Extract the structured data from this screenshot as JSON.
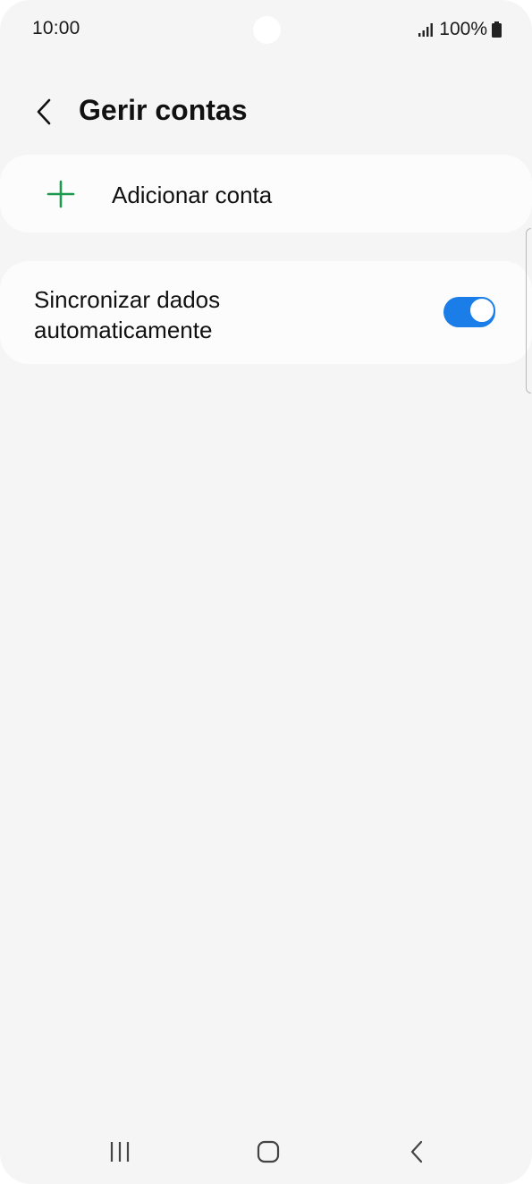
{
  "status_bar": {
    "time": "10:00",
    "battery": "100%",
    "icons": [
      "signal-icon",
      "battery-icon"
    ]
  },
  "header": {
    "title": "Gerir contas",
    "back_icon": "back-arrow-icon"
  },
  "add_account": {
    "label": "Adicionar conta",
    "icon": "plus-icon",
    "icon_color": "#1d9a4f"
  },
  "sync": {
    "label": "Sincronizar dados automaticamente",
    "enabled": true,
    "toggle_color": "#1a7de8"
  },
  "nav_bar": {
    "icons": [
      "recent-apps-icon",
      "home-icon",
      "back-icon"
    ]
  }
}
